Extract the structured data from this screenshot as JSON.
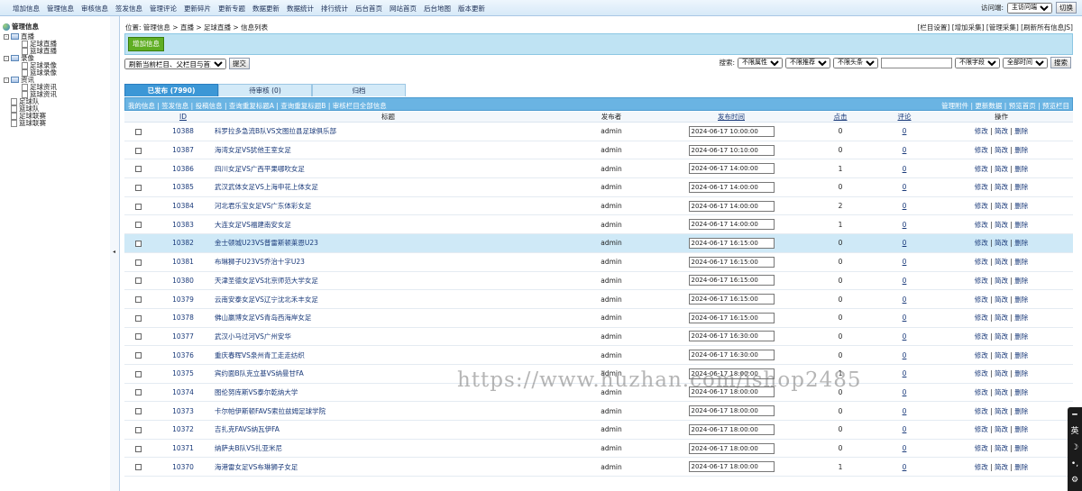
{
  "topnav": [
    "增加信息",
    "管理信息",
    "审核信息",
    "签发信息",
    "管理评论",
    "更新碎片",
    "更新专题",
    "数据更新",
    "数据统计",
    "排行统计",
    "后台首页",
    "网站首页",
    "后台地图",
    "版本更新"
  ],
  "visit": {
    "label": "访问端:",
    "value": "主访问端",
    "switch": "切换"
  },
  "tree": {
    "title": "管理信息",
    "nodes": [
      {
        "label": "直播",
        "indent": 0,
        "type": "folder",
        "sign": "-"
      },
      {
        "label": "足球直播",
        "indent": 1,
        "type": "page"
      },
      {
        "label": "篮球直播",
        "indent": 1,
        "type": "page"
      },
      {
        "label": "录像",
        "indent": 0,
        "type": "folder",
        "sign": "-"
      },
      {
        "label": "足球录像",
        "indent": 1,
        "type": "page"
      },
      {
        "label": "篮球录像",
        "indent": 1,
        "type": "page"
      },
      {
        "label": "资讯",
        "indent": 0,
        "type": "folder",
        "sign": "-"
      },
      {
        "label": "足球资讯",
        "indent": 1,
        "type": "page"
      },
      {
        "label": "篮球资讯",
        "indent": 1,
        "type": "page"
      },
      {
        "label": "足球队",
        "indent": 0,
        "type": "page"
      },
      {
        "label": "篮球队",
        "indent": 0,
        "type": "page"
      },
      {
        "label": "足球联赛",
        "indent": 0,
        "type": "page"
      },
      {
        "label": "篮球联赛",
        "indent": 0,
        "type": "page"
      }
    ]
  },
  "location": {
    "text": "位置: 管理信息 > 直播 > 足球直播 > 信息列表",
    "right": "[栏目设置] [增加采集] [管理采集] [刷新所有信息JS]"
  },
  "add_button": "增加信息",
  "refresh": {
    "select": "刷新当前栏目、父栏目与首页",
    "submit": "提交"
  },
  "search": {
    "label": "搜索:",
    "selects": [
      "不限属性",
      "不限推荐",
      "不限头条"
    ],
    "field_select": "不限字段",
    "time_select": "全部时间",
    "button": "搜索"
  },
  "tabs": [
    "已发布 (7990)",
    "待审核 (0)",
    "归档"
  ],
  "listbar": {
    "left": "我的信息 | 签发信息 | 投稿信息 | 查询重复标题A | 查询重复标题B | 审核栏目全部信息",
    "right": "管理附件 | 更新数据 | 预览首页 | 预览栏目"
  },
  "columns": {
    "id": "ID",
    "title": "标题",
    "publisher": "发布者",
    "time": "发布时间",
    "clicks": "点击",
    "comments": "评论",
    "ops": "操作"
  },
  "ops": {
    "edit": "修改",
    "simple": "简改",
    "delete": "删除"
  },
  "rows": [
    {
      "id": "10388",
      "title": "科罗拉多急流B队VS文图拉县足球俱乐部",
      "publisher": "admin",
      "time": "2024-06-17 10:00:00",
      "clicks": "0",
      "comments": "0"
    },
    {
      "id": "10387",
      "title": "海湾女足VS犹他王室女足",
      "publisher": "admin",
      "time": "2024-06-17 10:10:00",
      "clicks": "0",
      "comments": "0"
    },
    {
      "id": "10386",
      "title": "四川女足VS广西平果哪吹女足",
      "publisher": "admin",
      "time": "2024-06-17 14:00:00",
      "clicks": "1",
      "comments": "0"
    },
    {
      "id": "10385",
      "title": "武汉武体女足VS上海申花上体女足",
      "publisher": "admin",
      "time": "2024-06-17 14:00:00",
      "clicks": "0",
      "comments": "0"
    },
    {
      "id": "10384",
      "title": "河北君乐宝女足VS广东体彩女足",
      "publisher": "admin",
      "time": "2024-06-17 14:00:00",
      "clicks": "2",
      "comments": "0"
    },
    {
      "id": "10383",
      "title": "大连女足VS福建南安女足",
      "publisher": "admin",
      "time": "2024-06-17 14:00:00",
      "clicks": "1",
      "comments": "0"
    },
    {
      "id": "10382",
      "title": "金士顿城U23VS普雷斯顿莱恩U23",
      "publisher": "admin",
      "time": "2024-06-17 16:15:00",
      "clicks": "0",
      "comments": "0"
    },
    {
      "id": "10381",
      "title": "布琳狮子U23VS乔治十字U23",
      "publisher": "admin",
      "time": "2024-06-17 16:15:00",
      "clicks": "0",
      "comments": "0"
    },
    {
      "id": "10380",
      "title": "天津圣德女足VS北京师范大学女足",
      "publisher": "admin",
      "time": "2024-06-17 16:15:00",
      "clicks": "0",
      "comments": "0"
    },
    {
      "id": "10379",
      "title": "云南安泰女足VS辽宁沈北禾丰女足",
      "publisher": "admin",
      "time": "2024-06-17 16:15:00",
      "clicks": "0",
      "comments": "0"
    },
    {
      "id": "10378",
      "title": "佛山嬴博女足VS青岛西海岸女足",
      "publisher": "admin",
      "time": "2024-06-17 16:15:00",
      "clicks": "0",
      "comments": "0"
    },
    {
      "id": "10377",
      "title": "武汉小马过河VS广州安华",
      "publisher": "admin",
      "time": "2024-06-17 16:30:00",
      "clicks": "0",
      "comments": "0"
    },
    {
      "id": "10376",
      "title": "重庆春晖VS泉州青工走走纺织",
      "publisher": "admin",
      "time": "2024-06-17 16:30:00",
      "clicks": "0",
      "comments": "0"
    },
    {
      "id": "10375",
      "title": "宾约面B队克立基VS纳曼甘FA",
      "publisher": "admin",
      "time": "2024-06-17 18:00:00",
      "clicks": "1",
      "comments": "0"
    },
    {
      "id": "10374",
      "title": "图伦努库斯VS泰尔乾纳大学",
      "publisher": "admin",
      "time": "2024-06-17 18:00:00",
      "clicks": "0",
      "comments": "0"
    },
    {
      "id": "10373",
      "title": "卡尔帕伊斯顿FAVS索拉兹姆足球学院",
      "publisher": "admin",
      "time": "2024-06-17 18:00:00",
      "clicks": "0",
      "comments": "0"
    },
    {
      "id": "10372",
      "title": "吉扎克FAVS纳瓦伊FA",
      "publisher": "admin",
      "time": "2024-06-17 18:00:00",
      "clicks": "0",
      "comments": "0"
    },
    {
      "id": "10371",
      "title": "纳萨夫B队VS扎亚米尼",
      "publisher": "admin",
      "time": "2024-06-17 18:00:00",
      "clicks": "0",
      "comments": "0"
    },
    {
      "id": "10370",
      "title": "海港雷女足VS布琳狮子女足",
      "publisher": "admin",
      "time": "2024-06-17 18:00:00",
      "clicks": "1",
      "comments": "0"
    }
  ],
  "highlighted_row": "10382",
  "watermark": "https://www.huzhan.com/ishop2485"
}
